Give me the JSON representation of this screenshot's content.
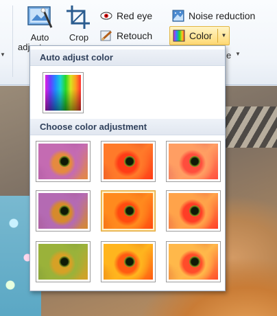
{
  "ribbon": {
    "auto_adjust_label_1": "Auto",
    "auto_adjust_label_2": "adjust",
    "crop_label": "Crop",
    "red_eye_label": "Red eye",
    "retouch_label": "Retouch",
    "noise_reduction_label": "Noise reduction",
    "color_label": "Color",
    "right_fragment": "e"
  },
  "dropdown": {
    "auto_section_title": "Auto adjust color",
    "choose_section_title": "Choose color adjustment",
    "selected_index": 4,
    "tiles": [
      {
        "name": "color-preset-1",
        "tint": [
          "#c46bb2",
          "#e58a3f",
          "#9a4b93"
        ]
      },
      {
        "name": "color-preset-2",
        "tint": [
          "#ff7a2a",
          "#ff3b16",
          "#cf2a1a"
        ]
      },
      {
        "name": "color-preset-3",
        "tint": [
          "#ff9e63",
          "#ff4d3d",
          "#d13b54"
        ]
      },
      {
        "name": "color-preset-4",
        "tint": [
          "#b46ab3",
          "#d68a2c",
          "#9a4a76"
        ]
      },
      {
        "name": "color-preset-5",
        "tint": [
          "#ff8a1e",
          "#ff4a0f",
          "#e23d08"
        ]
      },
      {
        "name": "color-preset-6",
        "tint": [
          "#ffa34a",
          "#ff3d26",
          "#d8283b"
        ]
      },
      {
        "name": "color-preset-7",
        "tint": [
          "#9ab23a",
          "#d6a126",
          "#6a8a3a"
        ]
      },
      {
        "name": "color-preset-8",
        "tint": [
          "#ffb51e",
          "#ff5a12",
          "#d24a10"
        ]
      },
      {
        "name": "color-preset-9",
        "tint": [
          "#ffb84a",
          "#ff4c2a",
          "#d13a2a"
        ]
      }
    ]
  },
  "colors": {
    "accent": "#ffd973",
    "header_text": "#30415c"
  }
}
